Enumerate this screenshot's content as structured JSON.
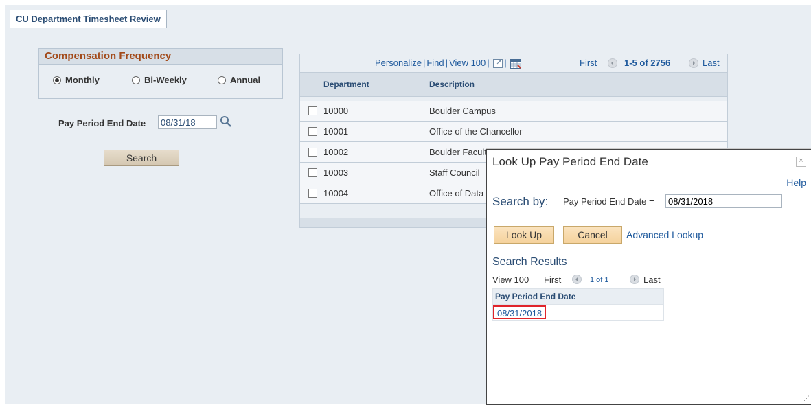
{
  "tab": {
    "label": "CU Department Timesheet Review"
  },
  "compensation": {
    "title": "Compensation Frequency",
    "options": [
      {
        "label": "Monthly",
        "selected": true
      },
      {
        "label": "Bi-Weekly",
        "selected": false
      },
      {
        "label": "Annual",
        "selected": false
      }
    ]
  },
  "pay_period": {
    "label": "Pay Period End Date",
    "value": "08/31/18",
    "lookup_icon": "search-icon"
  },
  "search_button": "Search",
  "grid": {
    "personalize": "Personalize",
    "find": "Find",
    "view": "View 100",
    "sep": "|",
    "first": "First",
    "range": "1-5 of 2756",
    "last": "Last",
    "headers": [
      "Department",
      "Description"
    ],
    "rows": [
      {
        "dept": "10000",
        "desc": "Boulder Campus"
      },
      {
        "dept": "10001",
        "desc": "Office of the Chancellor"
      },
      {
        "dept": "10002",
        "desc": "Boulder Facult"
      },
      {
        "dept": "10003",
        "desc": "Staff Council"
      },
      {
        "dept": "10004",
        "desc": "Office of Data"
      }
    ]
  },
  "modal": {
    "title": "Look Up Pay Period End Date",
    "close": "×",
    "help": "Help",
    "search_by": "Search by:",
    "field_label": "Pay Period End Date =",
    "field_value": "08/31/2018",
    "lookup_button": "Look Up",
    "cancel_button": "Cancel",
    "advanced": "Advanced Lookup",
    "results_title": "Search Results",
    "results_view": "View 100",
    "results_first": "First",
    "results_range": "1 of 1",
    "results_last": "Last",
    "results_header": "Pay Period End Date",
    "results_value": "08/31/2018"
  },
  "colors": {
    "link": "#1f5a9d",
    "highlight": "#e0242a",
    "title": "#a24a1a"
  }
}
